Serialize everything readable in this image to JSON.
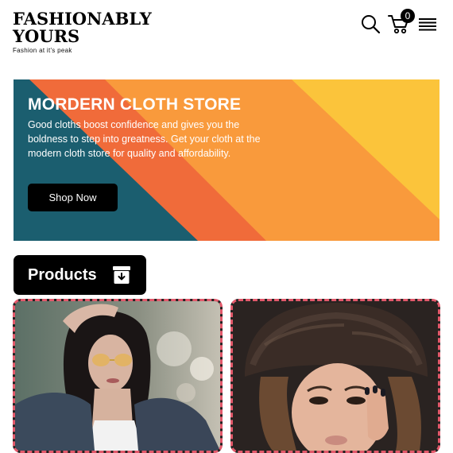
{
  "header": {
    "logo_line1": "FASHIONABLY",
    "logo_line2": "YOURS",
    "tagline": "Fashion at it's peak",
    "cart_count": "0",
    "icons": [
      "search-icon",
      "cart-icon",
      "menu-icon"
    ]
  },
  "banner": {
    "title": "MORDERN CLOTH STORE",
    "text": "Good cloths boost confidence and gives you the boldness to step into greatness. Get your cloth at the modern cloth store for quality and affordability.",
    "button_label": "Shop Now",
    "colors": {
      "teal": "#1b5e6f",
      "orange": "#f06b3a",
      "light_orange": "#f99a3c",
      "yellow": "#fbc43b"
    }
  },
  "products": {
    "heading": "Products",
    "icon": "archive-download-icon",
    "accent": "#e3596b",
    "items": [
      {
        "image": "woman-in-denim-jacket-with-yellow-glasses"
      },
      {
        "image": "woman-in-fur-hat"
      }
    ]
  }
}
